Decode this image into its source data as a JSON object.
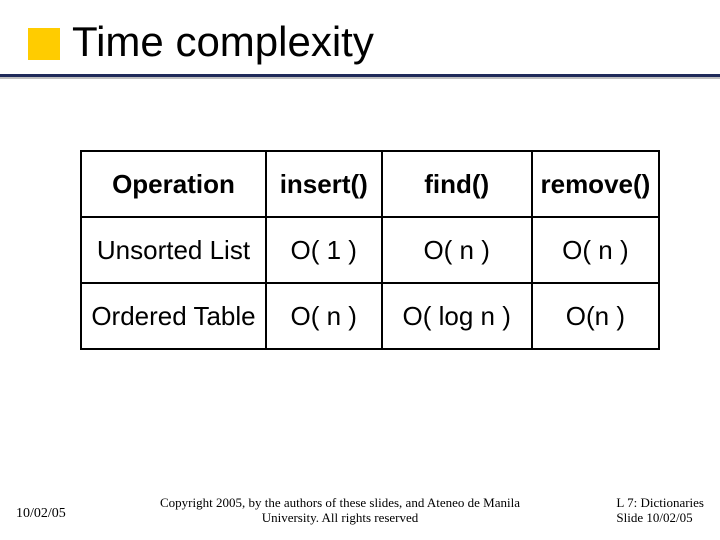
{
  "title": "Time complexity",
  "table": {
    "headers": [
      "Operation",
      "insert()",
      "find()",
      "remove()"
    ],
    "rows": [
      {
        "label": "Unsorted List",
        "insert": "O( 1 )",
        "find": "O( n )",
        "remove": "O( n )"
      },
      {
        "label": "Ordered Table",
        "insert": "O( n )",
        "find": "O( log n )",
        "remove": "O(n )"
      }
    ]
  },
  "footer": {
    "left": "10/02/05",
    "center": "Copyright 2005, by the authors of these slides, and Ateneo de Manila University. All rights reserved",
    "right_line1": "L 7: Dictionaries",
    "right_line2": "Slide 10/02/05"
  },
  "chart_data": {
    "type": "table",
    "title": "Time complexity",
    "columns": [
      "Operation",
      "insert()",
      "find()",
      "remove()"
    ],
    "rows": [
      [
        "Unsorted List",
        "O( 1 )",
        "O( n )",
        "O( n )"
      ],
      [
        "Ordered Table",
        "O( n )",
        "O( log n )",
        "O(n )"
      ]
    ]
  }
}
